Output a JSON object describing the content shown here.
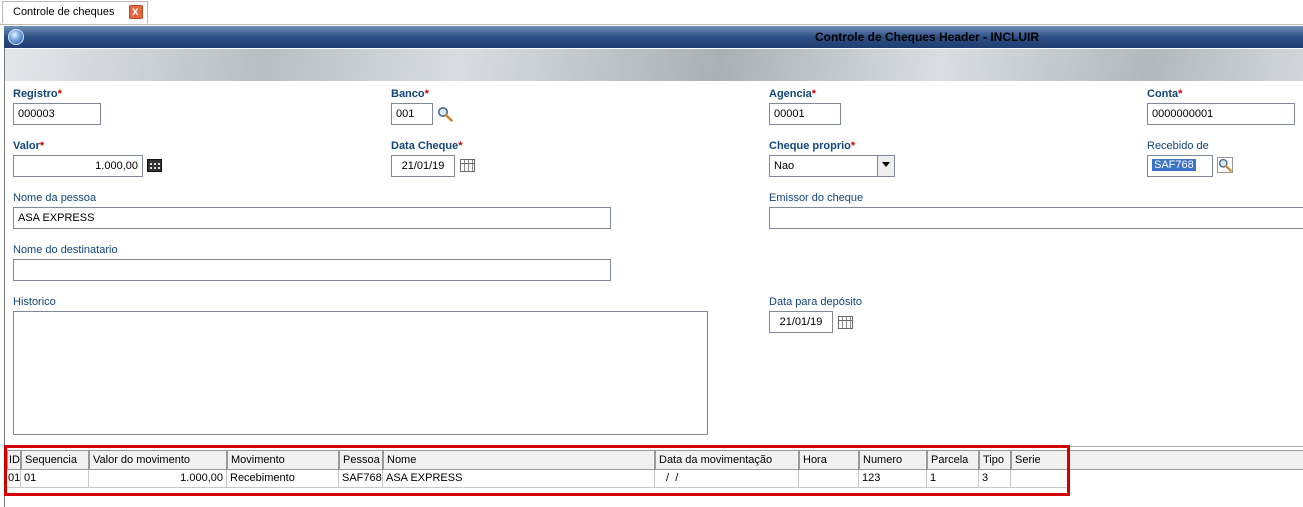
{
  "tab": {
    "label": "Controle de cheques",
    "close_glyph": "x"
  },
  "window": {
    "title": "Controle de Cheques Header - INCLUIR"
  },
  "form": {
    "registro": {
      "label": "Registro",
      "req": "*",
      "value": "000003"
    },
    "banco": {
      "label": "Banco",
      "req": "*",
      "value": "001"
    },
    "agencia": {
      "label": "Agencia",
      "req": "*",
      "value": "00001"
    },
    "conta": {
      "label": "Conta",
      "req": "*",
      "value": "0000000001"
    },
    "valor": {
      "label": "Valor",
      "req": "*",
      "value": "1.000,00"
    },
    "data_cheque": {
      "label": "Data Cheque",
      "req": "*",
      "value": "21/01/19"
    },
    "cheque_proprio": {
      "label": "Cheque proprio",
      "req": "*",
      "value": "Nao"
    },
    "recebido_de": {
      "label": "Recebido de",
      "value": "SAF768"
    },
    "nome_pessoa": {
      "label": "Nome da pessoa",
      "value": "ASA EXPRESS"
    },
    "emissor": {
      "label": "Emissor do cheque",
      "value": ""
    },
    "destinatario": {
      "label": "Nome do destinatario",
      "value": ""
    },
    "historico": {
      "label": "Historico",
      "value": ""
    },
    "data_deposito": {
      "label": "Data para depósito",
      "value": "21/01/19"
    }
  },
  "grid": {
    "columns": [
      "ID",
      "Sequencia",
      "Valor do movimento",
      "Movimento",
      "Pessoa",
      "Nome",
      "Data da movimentação",
      "Hora",
      "Numero",
      "Parcela",
      "Tipo",
      "Serie"
    ],
    "rows": [
      [
        "01",
        "01",
        "1.000,00",
        "Recebimento",
        "SAF768",
        "ASA EXPRESS",
        " /  /",
        "",
        "123",
        "1",
        "3",
        ""
      ]
    ]
  },
  "colors": {
    "title_bar": "#2e4f86",
    "label": "#12457a",
    "required": "#cc0000",
    "highlight_box": "#d40000",
    "selection": "#3b73c6"
  }
}
